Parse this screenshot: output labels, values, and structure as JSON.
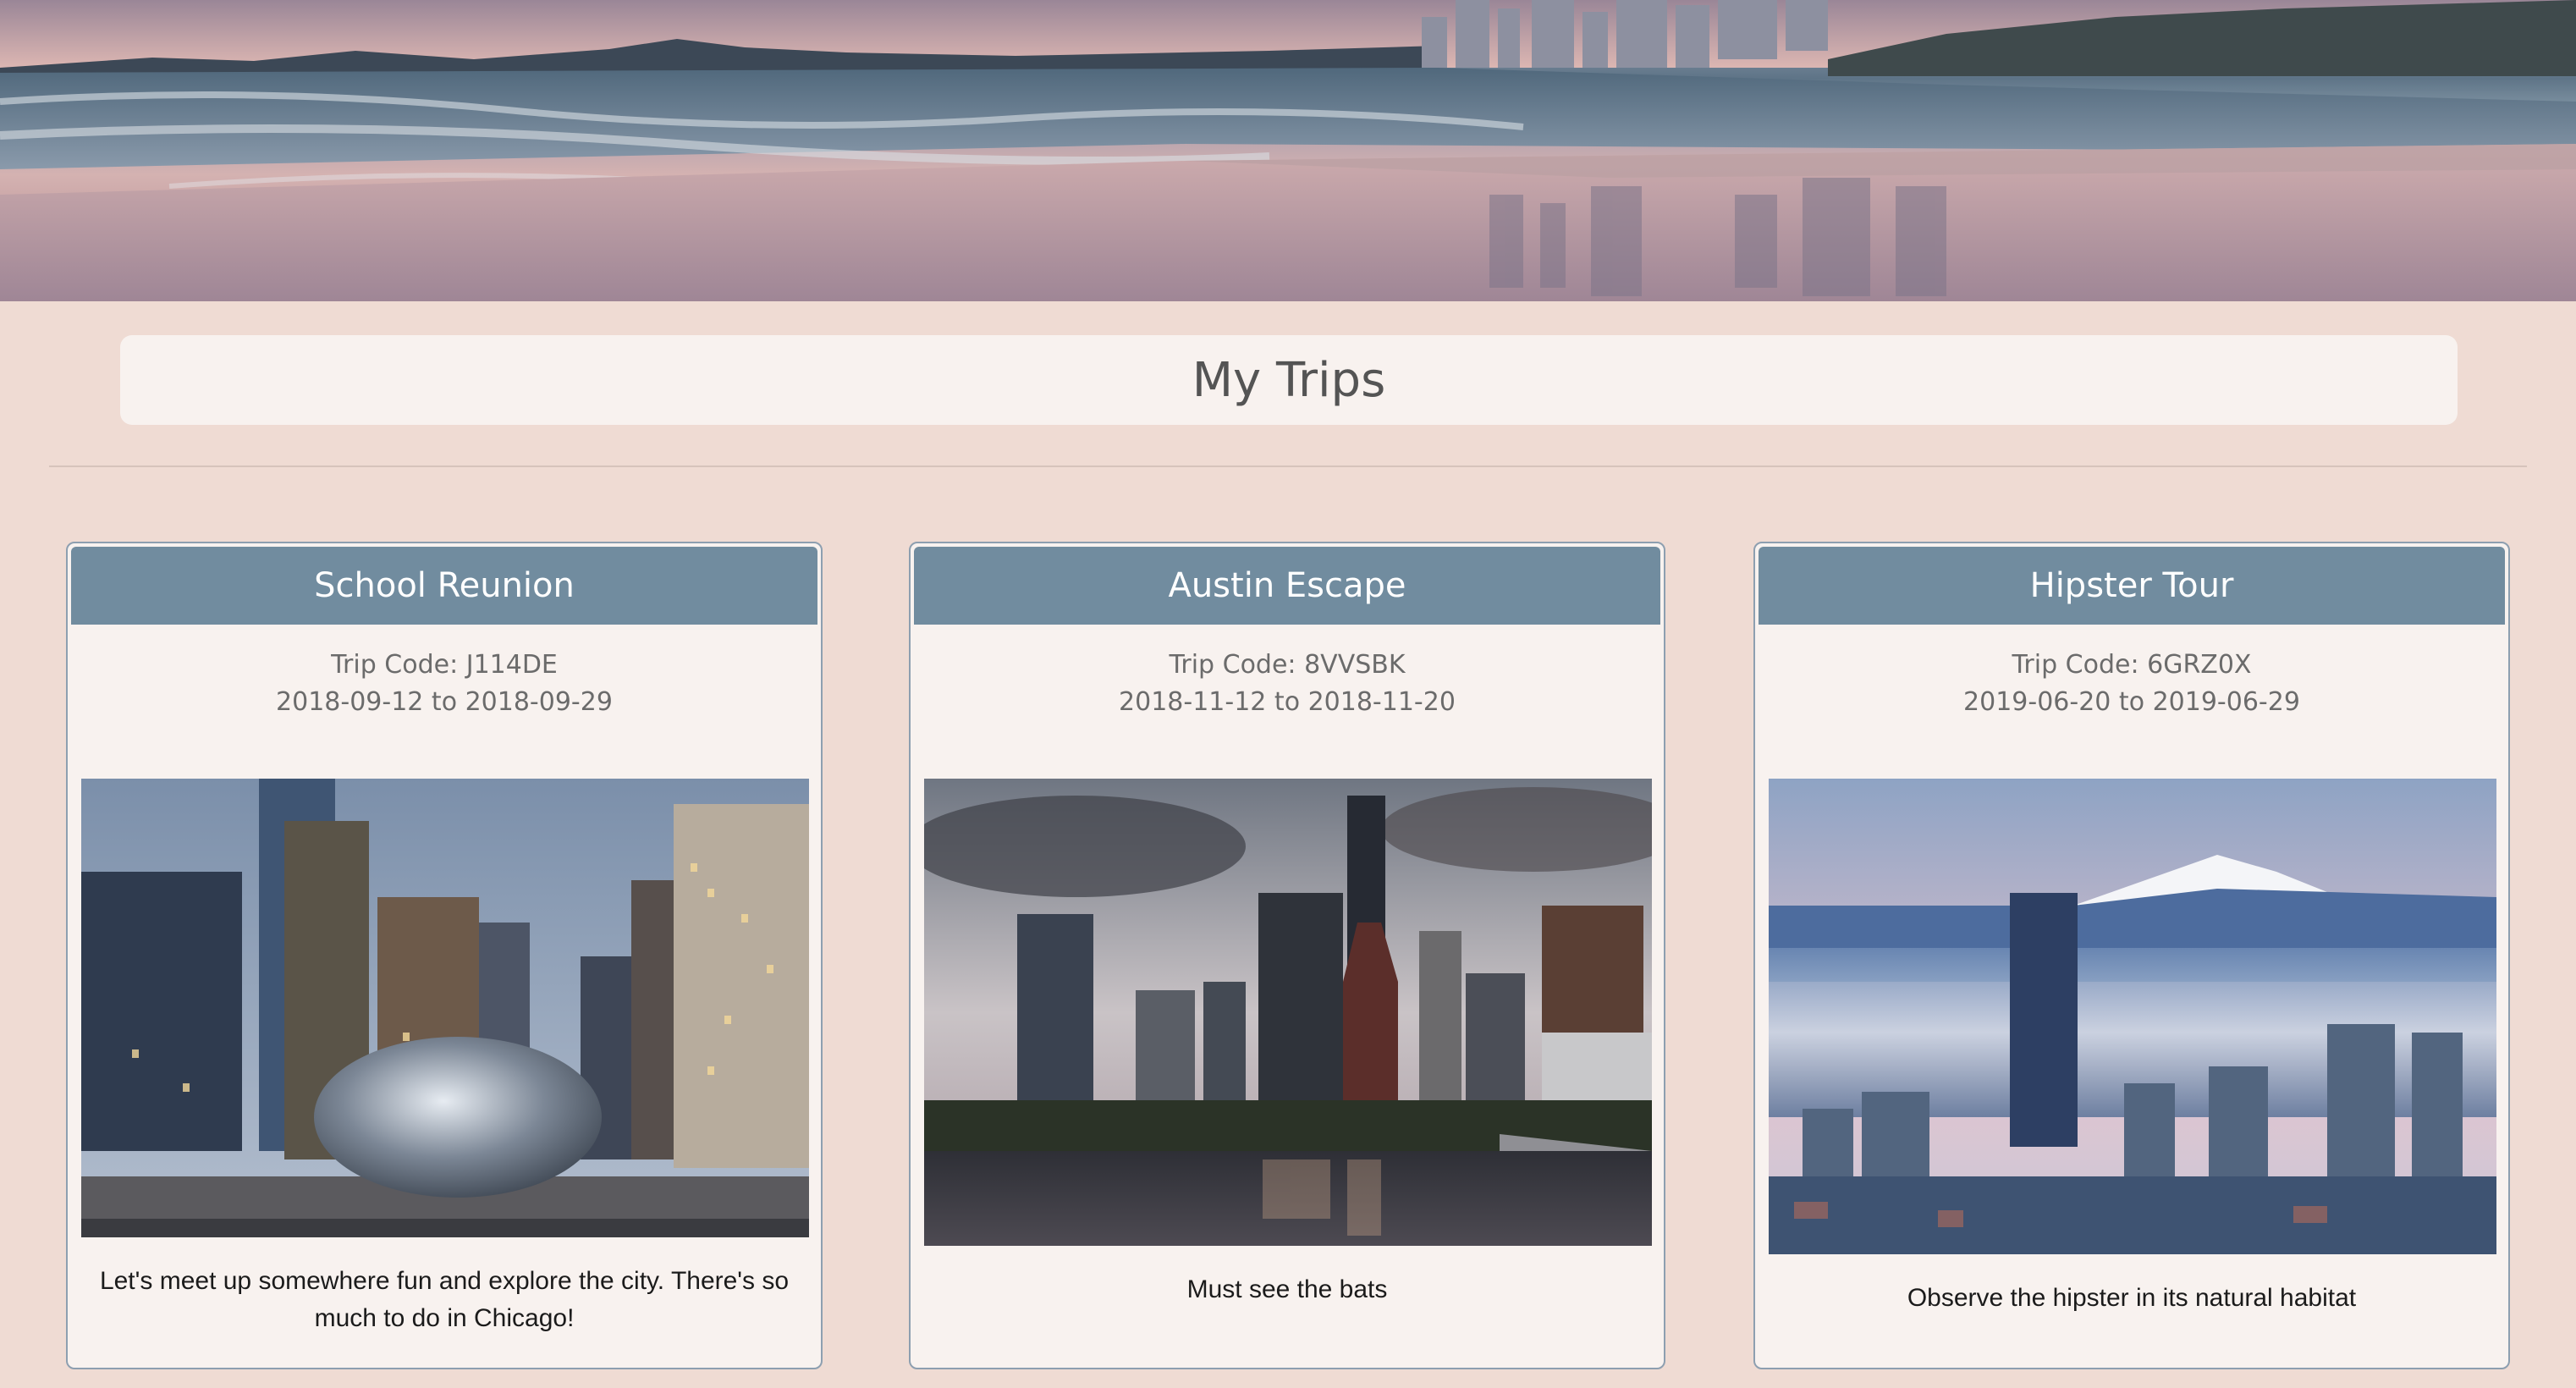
{
  "page": {
    "title": "My Trips"
  },
  "hero": {
    "icon": "beach-skyline-banner"
  },
  "trips": [
    {
      "name": "School Reunion",
      "code": "Trip Code: J114DE",
      "dates": "2018-09-12 to 2018-09-29",
      "image_icon": "chicago-bean-photo",
      "description": "Let's meet up somewhere fun and explore the city. There's so much to do in Chicago!"
    },
    {
      "name": "Austin Escape",
      "code": "Trip Code: 8VVSBK",
      "dates": "2018-11-12 to 2018-11-20",
      "image_icon": "austin-skyline-photo",
      "description": "Must see the bats"
    },
    {
      "name": "Hipster Tour",
      "code": "Trip Code: 6GRZ0X",
      "dates": "2019-06-20 to 2019-06-29",
      "image_icon": "portland-mount-hood-photo",
      "description": "Observe the hipster in its natural habitat"
    }
  ],
  "colors": {
    "background": "#efdbd3",
    "card_header": "#718c9f",
    "card_body": "#f8f2ef",
    "card_border": "#8d9fb0"
  }
}
